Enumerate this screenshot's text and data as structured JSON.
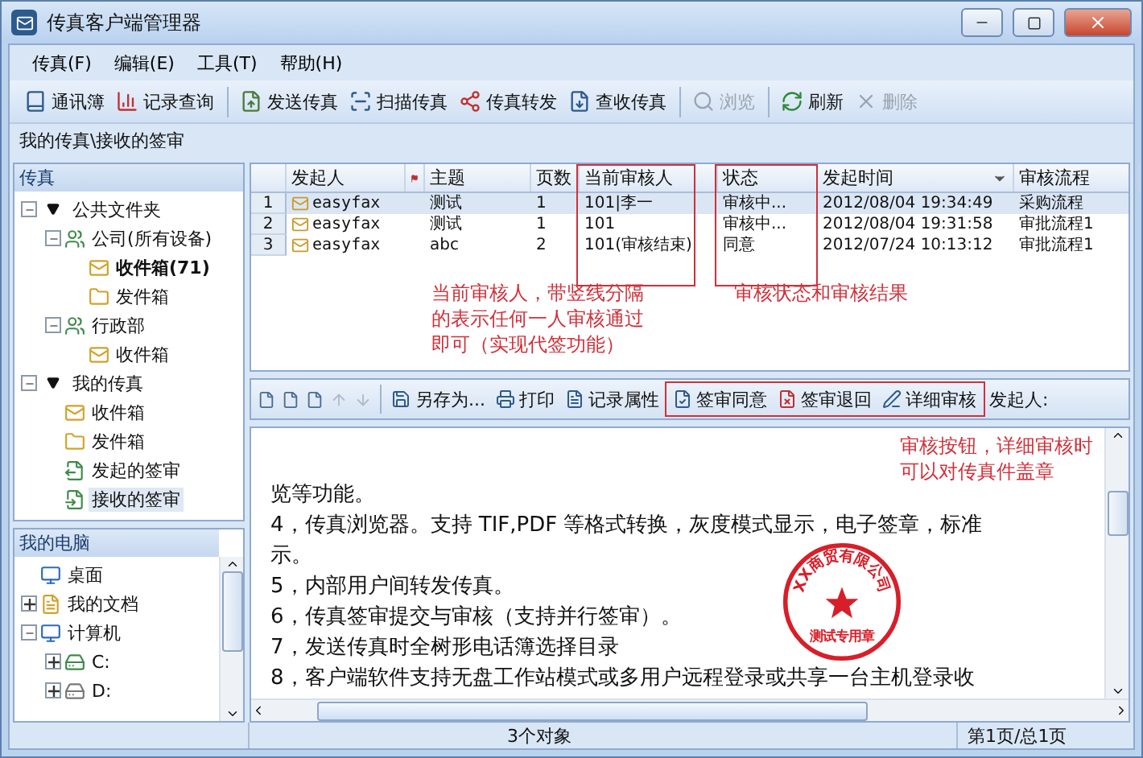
{
  "window": {
    "title": "传真客户端管理器"
  },
  "menu": [
    {
      "label": "传真(F)"
    },
    {
      "label": "编辑(E)"
    },
    {
      "label": "工具(T)"
    },
    {
      "label": "帮助(H)"
    }
  ],
  "toolbar": [
    {
      "label": "通讯簿",
      "kind": "addressbook",
      "disabled": false,
      "separator_before": false
    },
    {
      "label": "记录查询",
      "kind": "chart",
      "disabled": false,
      "separator_before": false
    },
    {
      "label": "发送传真",
      "kind": "send",
      "disabled": false,
      "separator_before": true
    },
    {
      "label": "扫描传真",
      "kind": "scan",
      "disabled": false,
      "separator_before": false
    },
    {
      "label": "传真转发",
      "kind": "forward",
      "disabled": false,
      "separator_before": false
    },
    {
      "label": "查收传真",
      "kind": "receive",
      "disabled": false,
      "separator_before": false
    },
    {
      "label": "浏览",
      "kind": "view",
      "disabled": true,
      "separator_before": true
    },
    {
      "label": "刷新",
      "kind": "refresh",
      "disabled": false,
      "separator_before": true
    },
    {
      "label": "删除",
      "kind": "delete",
      "disabled": true,
      "separator_before": false
    }
  ],
  "breadcrumb": "我的传真\\接收的签审",
  "fax_tree": {
    "title": "传真",
    "items": [
      {
        "label": "公共文件夹",
        "kind": "section",
        "expanded": true,
        "selected": false,
        "children": [
          {
            "label": "公司(所有设备)",
            "kind": "group",
            "expanded": true,
            "selected": false,
            "children": [
              {
                "label": "收件箱(71)",
                "kind": "inbox",
                "unread": true,
                "selected": false
              },
              {
                "label": "发件箱",
                "kind": "outbox",
                "unread": false,
                "selected": false
              }
            ]
          },
          {
            "label": "行政部",
            "kind": "group",
            "expanded": true,
            "selected": false,
            "children": [
              {
                "label": "收件箱",
                "kind": "inbox",
                "unread": false,
                "selected": false
              }
            ]
          }
        ]
      },
      {
        "label": "我的传真",
        "kind": "section",
        "expanded": true,
        "selected": false,
        "children": [
          {
            "label": "收件箱",
            "kind": "inbox",
            "unread": false,
            "selected": false
          },
          {
            "label": "发件箱",
            "kind": "outbox",
            "unread": false,
            "selected": false
          },
          {
            "label": "发起的签审",
            "kind": "sign-out",
            "unread": false,
            "selected": false
          },
          {
            "label": "接收的签审",
            "kind": "sign-in",
            "unread": false,
            "selected": true
          }
        ]
      }
    ]
  },
  "computer_tree": {
    "title": "我的电脑",
    "items": [
      {
        "label": "桌面",
        "kind": "desktop"
      },
      {
        "label": "我的文档",
        "kind": "documents",
        "expanded": false
      },
      {
        "label": "计算机",
        "kind": "computer",
        "expanded": true,
        "children": [
          {
            "label": "C:",
            "kind": "system-drive",
            "expanded": false
          },
          {
            "label": "D:",
            "kind": "drive",
            "expanded": false
          }
        ]
      }
    ]
  },
  "table": {
    "columns": [
      {
        "label": "发起人",
        "highlighted": false,
        "sorted": false
      },
      {
        "label": "主题",
        "highlighted": false,
        "sorted": false
      },
      {
        "label": "页数",
        "highlighted": false,
        "sorted": false
      },
      {
        "label": "当前审核人",
        "highlighted": true,
        "sorted": false
      },
      {
        "label": "状态",
        "highlighted": true,
        "sorted": false
      },
      {
        "label": "发起时间",
        "highlighted": false,
        "sorted": true
      },
      {
        "label": "审核流程",
        "highlighted": false,
        "sorted": false
      }
    ],
    "rows": [
      {
        "number": "1",
        "selected": true,
        "cells": [
          "easyfax",
          "测试",
          "1",
          "101|李一",
          "审核中...",
          "2012/08/04  19:34:49",
          "采购流程"
        ]
      },
      {
        "number": "2",
        "selected": false,
        "cells": [
          "easyfax",
          "测试",
          "1",
          "101",
          "审核中...",
          "2012/08/04  19:31:58",
          "审批流程1"
        ]
      },
      {
        "number": "3",
        "selected": false,
        "cells": [
          "easyfax",
          "abc",
          "2",
          "101(审核结束)",
          "同意",
          "2012/07/24  10:13:12",
          "审批流程1"
        ]
      }
    ]
  },
  "annotations": [
    {
      "lines": [
        "当前审核人，带竖线分隔",
        "的表示任何一人审核通过",
        "即可（实现代签功能）"
      ]
    },
    {
      "lines": [
        "审核状态和审核结果"
      ]
    },
    {
      "lines": [
        "审核按钮，详细审核时",
        "可以对传真件盖章"
      ]
    }
  ],
  "preview_toolbar": {
    "tools": [
      {
        "kind": "page-first",
        "disabled": false
      },
      {
        "kind": "page",
        "disabled": false
      },
      {
        "kind": "page-last",
        "disabled": false
      },
      {
        "kind": "up",
        "disabled": true
      },
      {
        "kind": "down",
        "disabled": true
      },
      {
        "kind": "save",
        "label": "另存为...",
        "disabled": false
      },
      {
        "kind": "print",
        "label": "打印",
        "disabled": false
      },
      {
        "kind": "properties",
        "label": "记录属性",
        "disabled": false
      }
    ],
    "review_buttons": {
      "highlighted": true,
      "items": [
        {
          "kind": "approve",
          "label": "签审同意"
        },
        {
          "kind": "reject",
          "label": "签审退回"
        },
        {
          "kind": "detail",
          "label": "详细审核"
        }
      ]
    },
    "sender_label": "发起人:"
  },
  "document": {
    "lines": [
      "览等功能。",
      "4，传真浏览器。支持 TIF,PDF 等格式转换，灰度模式显示，电子签章，标准",
      "示。",
      "5，内部用户间转发传真。",
      "6，传真签审提交与审核（支持并行签审）。",
      "7，发送传真时全树形电话簿选择目录",
      "8，客户端软件支持无盘工作站模式或多用户远程登录或共享一台主机登录收"
    ],
    "stamp": {
      "company": "XX商贸有限公司",
      "caption": "测试专用章"
    }
  },
  "status_bar": {
    "count": "3个对象",
    "page": "第1页/总1页"
  }
}
